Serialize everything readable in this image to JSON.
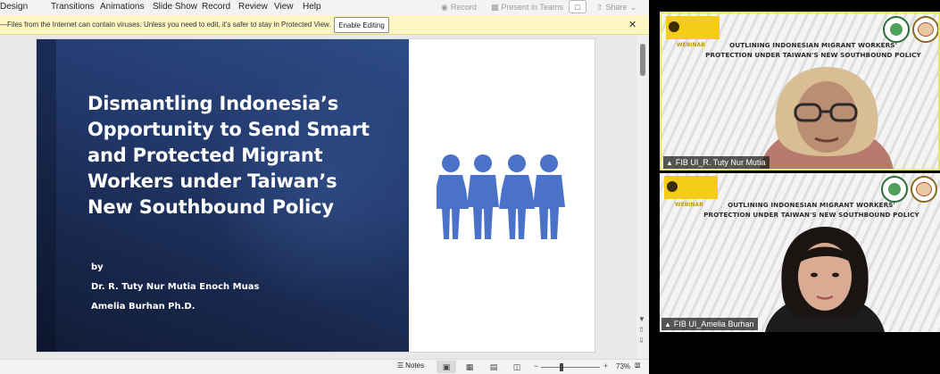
{
  "ribbon": {
    "menu": [
      "Design",
      "Transitions",
      "Animations",
      "Slide Show",
      "Record",
      "Review",
      "View",
      "Help"
    ],
    "record_label": "Record",
    "present_label": "Present in Teams",
    "share_label": "Share"
  },
  "infobar": {
    "message": "—Files from the Internet can contain viruses. Unless you need to edit, it's safer to stay in Protected View.",
    "enable_label": "Enable Editing",
    "close_glyph": "✕"
  },
  "slide": {
    "title": "Dismantling Indonesia’s Opportunity to Send Smart and Protected Migrant Workers under Taiwan’s New Southbound Policy",
    "by": "by",
    "authors": [
      "Dr. R. Tuty Nur Mutia Enoch Muas",
      "Amelia Burhan Ph.D."
    ],
    "icon": "people-group-icon",
    "icon_color": "#4a72c8"
  },
  "statusbar": {
    "notes_label": "Notes",
    "zoom_level": "73%",
    "zoom_fraction": 0.35
  },
  "meeting": {
    "tiles": [
      {
        "heading_line1": "OUTLINING INDONESIAN MIGRANT WORKERS'",
        "heading_line2": "PROTECTION UNDER TAIWAN'S NEW SOUTHBOUND POLICY",
        "webinar": "WEBINAR",
        "participant": "FIB UI_R. Tuty Nur Mutia"
      },
      {
        "heading_line1": "OUTLINING INDONESIAN MIGRANT WORKERS'",
        "heading_line2": "PROTECTION UNDER TAIWAN'S NEW SOUTHBOUND POLICY",
        "webinar": "WEBINAR",
        "participant": "FIB UI_Amelia Burhan"
      }
    ],
    "active_speaker_color": "#e3e86c"
  }
}
